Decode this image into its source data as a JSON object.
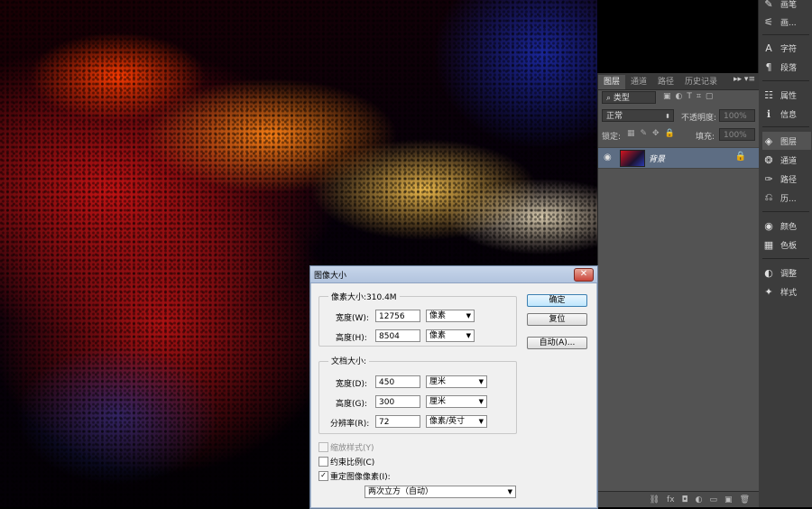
{
  "dock": {
    "items": [
      {
        "label": "画笔",
        "icon": "brush-icon",
        "glyph": "✎"
      },
      {
        "label": "画...",
        "icon": "brush-preset-icon",
        "glyph": "⚟"
      },
      {
        "label": "字符",
        "icon": "character-icon",
        "glyph": "A"
      },
      {
        "label": "段落",
        "icon": "paragraph-icon",
        "glyph": "¶"
      },
      {
        "label": "属性",
        "icon": "properties-icon",
        "glyph": "☷"
      },
      {
        "label": "信息",
        "icon": "info-icon",
        "glyph": "ℹ"
      },
      {
        "label": "图层",
        "icon": "layers-icon",
        "glyph": "◈"
      },
      {
        "label": "通道",
        "icon": "channels-icon",
        "glyph": "❂"
      },
      {
        "label": "路径",
        "icon": "paths-icon",
        "glyph": "✑"
      },
      {
        "label": "历...",
        "icon": "history-icon",
        "glyph": "⎌"
      },
      {
        "label": "颜色",
        "icon": "color-icon",
        "glyph": "◉"
      },
      {
        "label": "色板",
        "icon": "swatches-icon",
        "glyph": "▦"
      },
      {
        "label": "调整",
        "icon": "adjustments-icon",
        "glyph": "◐"
      },
      {
        "label": "样式",
        "icon": "styles-icon",
        "glyph": "✦"
      }
    ]
  },
  "layers_panel": {
    "tabs": [
      "图层",
      "通道",
      "路径",
      "历史记录"
    ],
    "filter_kind": "类型",
    "blend_mode": "正常",
    "opacity_label": "不透明度:",
    "opacity_value": "100%",
    "lock_label": "锁定:",
    "fill_label": "填充:",
    "fill_value": "100%",
    "layer_name": "背景",
    "menu_glyph": "▸▸ ▾≡",
    "bottom_icons": [
      "⛓",
      "fx",
      "◘",
      "◐",
      "▭",
      "▣",
      "🗑"
    ]
  },
  "dialog": {
    "title": "图像大小",
    "close_glyph": "✕",
    "pixel_group_title": "像素大小:310.4M",
    "width_label": "宽度(W):",
    "width_value": "12756",
    "width_unit": "像素",
    "height_label": "高度(H):",
    "height_value": "8504",
    "height_unit": "像素",
    "doc_group_title": "文档大小:",
    "doc_width_label": "宽度(D):",
    "doc_width_value": "450",
    "doc_width_unit": "厘米",
    "doc_height_label": "高度(G):",
    "doc_height_value": "300",
    "doc_height_unit": "厘米",
    "resolution_label": "分辨率(R):",
    "resolution_value": "72",
    "resolution_unit": "像素/英寸",
    "scale_styles_label": "缩放样式(Y)",
    "constrain_label": "约束比例(C)",
    "resample_label": "重定图像像素(I):",
    "resample_method": "两次立方（自动）",
    "ok_label": "确定",
    "reset_label": "复位",
    "auto_label": "自动(A)...",
    "checkmark": "✓"
  }
}
